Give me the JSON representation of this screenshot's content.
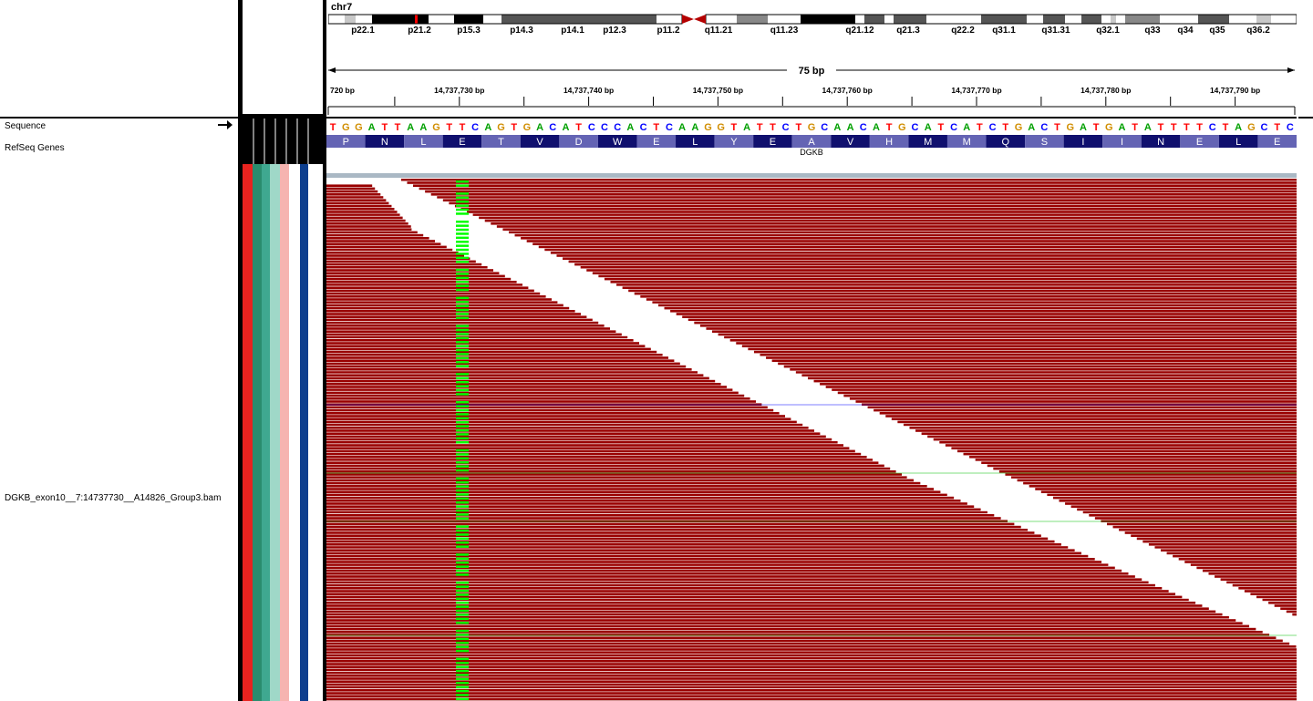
{
  "chromosome": "chr7",
  "ideogram_bands": [
    "p22.1",
    "p21.2",
    "p15.3",
    "p14.3",
    "p14.1",
    "p12.3",
    "p11.2",
    "q11.21",
    "q11.23",
    "q21.12",
    "q21.3",
    "q22.2",
    "q31.1",
    "q31.31",
    "q32.1",
    "q33",
    "q34",
    "q35",
    "q36.2"
  ],
  "ruler": {
    "span_label": "75 bp",
    "ticks": [
      "720 bp",
      "14,737,730 bp",
      "14,737,740 bp",
      "14,737,750 bp",
      "14,737,760 bp",
      "14,737,770 bp",
      "14,737,780 bp",
      "14,737,790 bp"
    ]
  },
  "tracks": {
    "sequence_label": "Sequence",
    "refseq_label": "RefSeq Genes",
    "bam_label": "DGKB_exon10__7:14737730__A14826_Group3.bam"
  },
  "sequence": "TGGATTAAGTTCAGTGACATCCCACTCAAGGTATTCTGCAACATGCATCATCTGACTGATGATATTTTCTAGCTC",
  "amino_acids": [
    "P",
    "N",
    "L",
    "E",
    "T",
    "V",
    "D",
    "W",
    "E",
    "L",
    "Y",
    "E",
    "A",
    "V",
    "H",
    "M",
    "M",
    "Q",
    "S",
    "I",
    "I",
    "N",
    "E",
    "L",
    "E"
  ],
  "gene_name": "DGKB",
  "colors": {
    "read_fill": "#990000",
    "mismatch": "#00ff00",
    "base_A": "#00a000",
    "base_C": "#0000ff",
    "base_G": "#d18e00",
    "base_T": "#ff0000",
    "aa_light": "#6464b4",
    "aa_dark": "#10106e",
    "attr_columns": [
      "#000000",
      "#e8231f",
      "#2a8c6e",
      "#3fa890",
      "#9fd8c8",
      "#f6b4b0",
      "#ffffff",
      "#0e3f8e",
      "#ffffff"
    ]
  }
}
